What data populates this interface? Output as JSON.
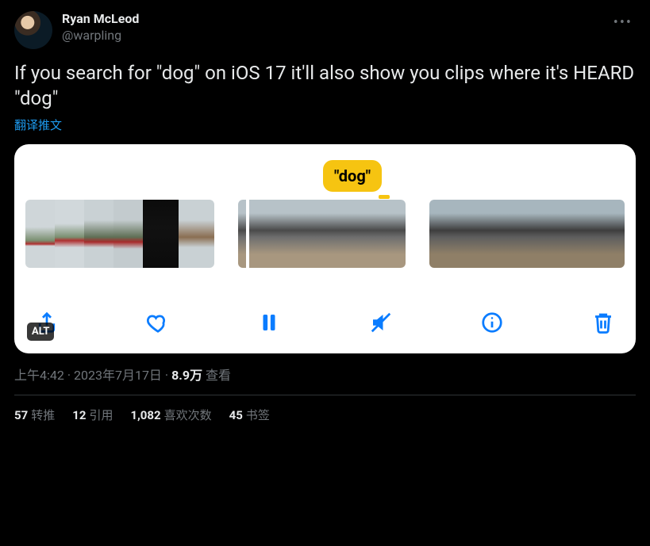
{
  "author": {
    "display_name": "Ryan McLeod",
    "handle": "@warpling"
  },
  "tweet_text": "If you search for \"dog\" on iOS 17 it'll also show you clips where it's HEARD \"dog\"",
  "translate_label": "翻译推文",
  "bubble_text": "\"dog\"",
  "alt_badge": "ALT",
  "meta": {
    "time": "上午4:42",
    "sep1": " · ",
    "date": "2023年7月17日",
    "sep2": " · ",
    "views_count": "8.9万",
    "views_label": " 查看"
  },
  "stats": {
    "retweets": {
      "count": "57",
      "label": "转推"
    },
    "quotes": {
      "count": "12",
      "label": "引用"
    },
    "likes": {
      "count": "1,082",
      "label": "喜欢次数"
    },
    "bookmarks": {
      "count": "45",
      "label": "书签"
    }
  },
  "icons": {
    "more": "•••"
  }
}
